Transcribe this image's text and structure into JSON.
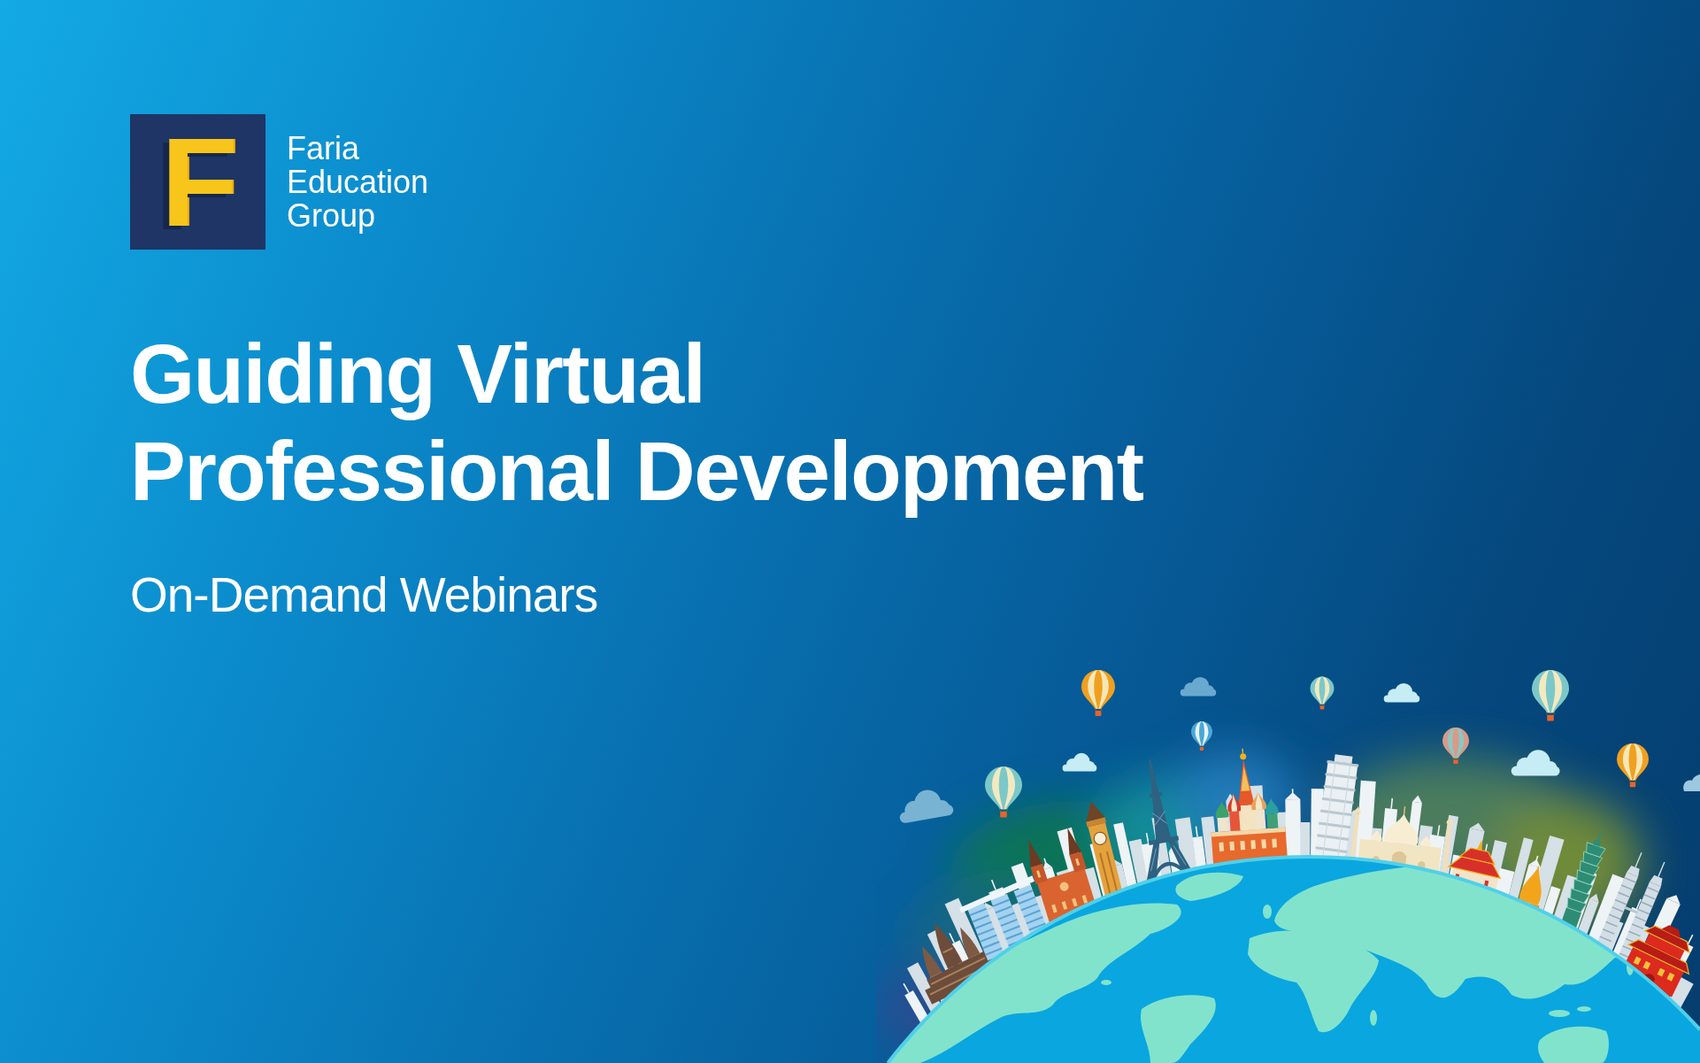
{
  "logo": {
    "mark": "F",
    "name_lines": [
      "Faria",
      "Education",
      "Group"
    ]
  },
  "title_lines": [
    "Guiding Virtual",
    "Professional Development"
  ],
  "subtitle": "On-Demand Webinars"
}
